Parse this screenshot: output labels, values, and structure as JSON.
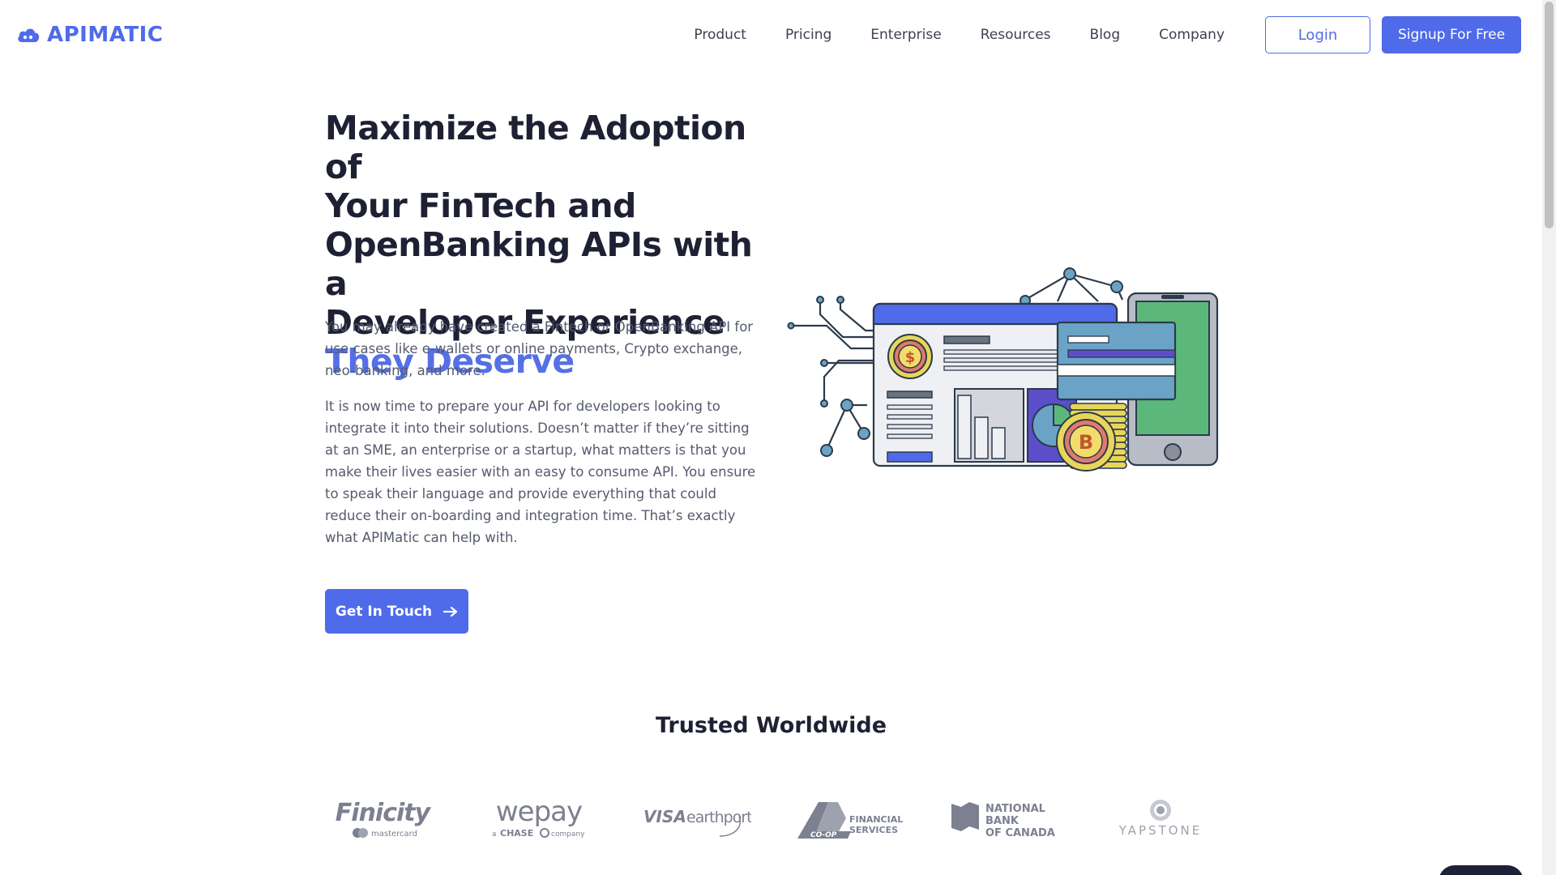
{
  "header": {
    "brand": "APIMATIC",
    "nav": [
      "Product",
      "Pricing",
      "Enterprise",
      "Resources",
      "Blog",
      "Company"
    ],
    "login_label": "Login",
    "signup_label": "Signup For Free"
  },
  "hero": {
    "title_line1": "Maximize the Adoption of",
    "title_line2": "Your FinTech and",
    "title_line3": "OpenBanking APIs with a",
    "title_line4": "Developer Experience",
    "title_accent": "They Deserve",
    "para1": "You may already have created a Fintech or OpenBanking API for use cases like e-wallets or online payments, Crypto exchange, neo-banking, and more.",
    "para2": "It is now time to prepare your API for developers looking to integrate it into their solutions. Doesn’t matter if they’re sitting at an SME, an enterprise or a startup, what matters is that you make their lives easier with an easy to consume API. You ensure to speak their language and provide everything that could reduce their on-boarding and integration time. That’s exactly what APIMatic can help with.",
    "cta_label": "Get In Touch"
  },
  "trusted": {
    "heading": "Trusted Worldwide",
    "logos": {
      "finicity": "Finicity",
      "finicity_sub": "mastercard",
      "wepay": "wepay",
      "wepay_sub_a": "a",
      "wepay_sub_chase": "CHASE",
      "wepay_sub_company": "company",
      "visa": "VISA",
      "earthport": "earthport",
      "coop": "CO-OP",
      "coop_fin1": "FINANCIAL",
      "coop_fin2": "SERVICES",
      "nbc1": "NATIONAL",
      "nbc2": "BANK",
      "nbc3": "OF CANADA",
      "yapstone": "YAPSTONE"
    }
  },
  "colors": {
    "accent": "#4f6bea",
    "heading": "#1e2033",
    "body_text": "#555a6e"
  }
}
